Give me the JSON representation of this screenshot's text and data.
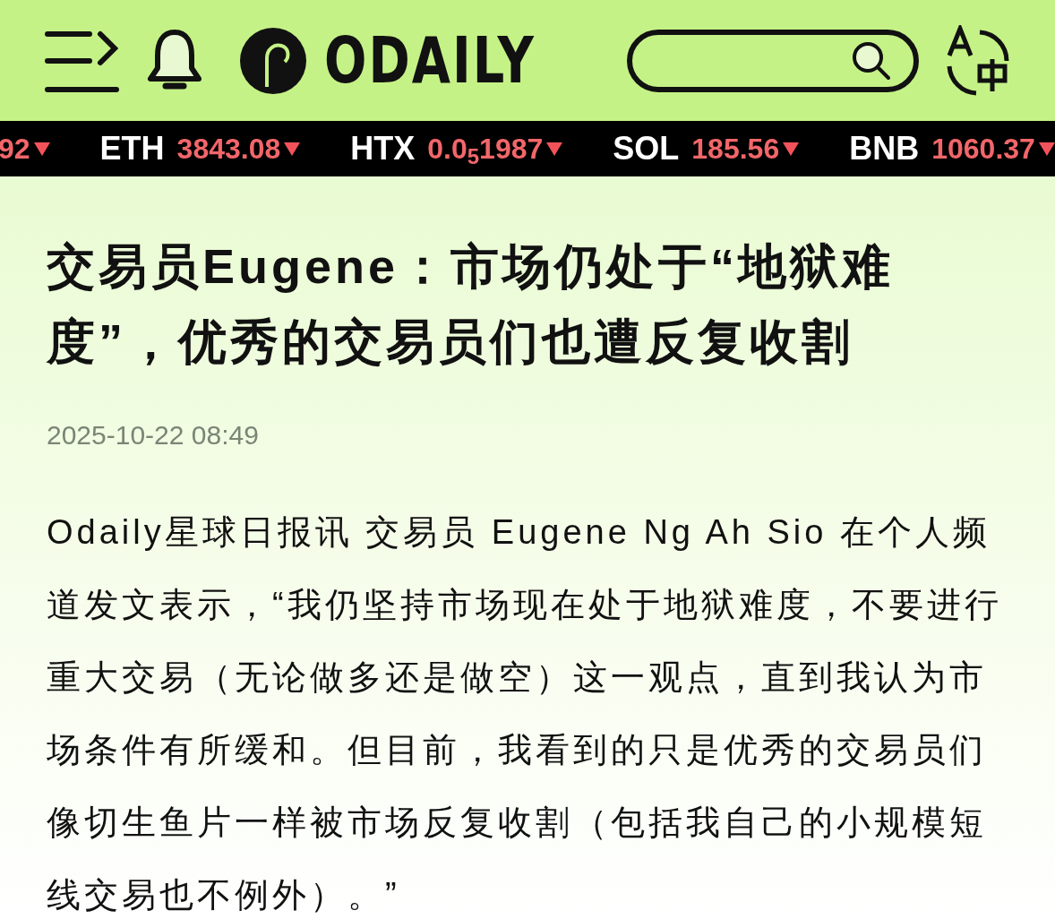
{
  "header": {
    "logo_text": "ODAILY"
  },
  "ticker": [
    {
      "price": "92",
      "falling": true
    },
    {
      "symbol": "ETH",
      "price": "3843.08",
      "falling": true
    },
    {
      "symbol": "HTX",
      "price": "0.0$_{5}$1987",
      "falling": true
    },
    {
      "symbol": "SOL",
      "price": "185.56",
      "falling": true
    },
    {
      "symbol": "BNB",
      "price": "1060.37",
      "falling": true
    }
  ],
  "article": {
    "title": "交易员Eugene：市场仍处于“地狱难度”，优秀的交易员们也遭反复收割",
    "date": "2025-10-22 08:49",
    "body": "Odaily星球日报讯 交易员 Eugene Ng Ah Sio 在个人频道发文表示，“我仍坚持市场现在处于地狱难度，不要进行重大交易（无论做多还是做空）这一观点，直到我认为市场条件有所缓和。但目前，我看到的只是优秀的交易员们像切生鱼片一样被市场反复收割（包括我自己的小规模短线交易也不例外）。”"
  }
}
